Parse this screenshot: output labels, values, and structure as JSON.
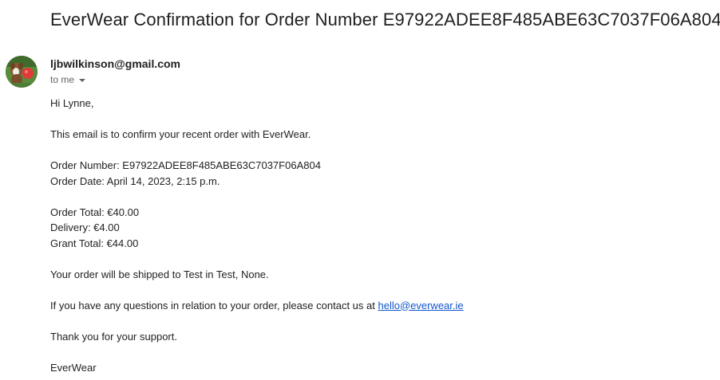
{
  "email": {
    "subject": "EverWear Confirmation for Order Number E97922ADEE8F485ABE63C7037F06A804",
    "sender": "ljbwilkinson@gmail.com",
    "recipient_label": "to me",
    "avatar_icon": "dog-photo-avatar",
    "body": {
      "greeting": "Hi Lynne,",
      "intro": "This email is to confirm your recent order with EverWear.",
      "order_number": "Order Number: E97922ADEE8F485ABE63C7037F06A804",
      "order_date": "Order Date: April 14, 2023, 2:15 p.m.",
      "order_total": "Order Total: €40.00",
      "delivery": "Delivery: €4.00",
      "grand_total": "Grant Total: €44.00",
      "shipping": "Your order will be shipped to Test in Test, None.",
      "contact_prefix": "If you have any questions in relation to your order, please contact us at ",
      "contact_email": "hello@everwear.ie",
      "thanks": "Thank you for your support.",
      "signature": "EverWear"
    }
  },
  "colors": {
    "link": "#1155cc",
    "text": "#222222",
    "secondary_text": "#5f6368"
  }
}
